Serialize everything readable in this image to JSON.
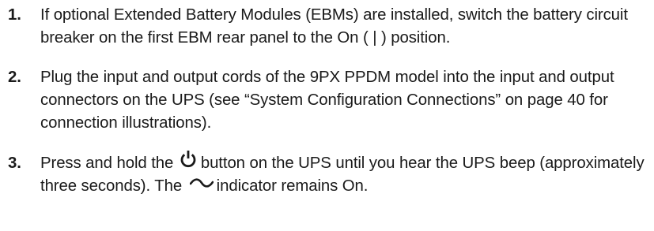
{
  "steps": [
    {
      "number": "1.",
      "text": "If optional Extended Battery Modules (EBMs) are installed, switch the battery circuit breaker on the first EBM rear panel to the On ( | ) position."
    },
    {
      "number": "2.",
      "text": "Plug the input and output cords of the 9PX PPDM model into the input and output connectors on the UPS (see “System Configuration Connections” on page 40 for connection illustrations)."
    },
    {
      "number": "3.",
      "text_before_power_icon": "Press and hold the",
      "text_after_power_icon": "button on the UPS until you hear the UPS beep (approximately three seconds). The",
      "text_after_ac_icon": "indicator remains On."
    }
  ],
  "icons": {
    "power": "power-icon",
    "ac_line": "ac-line-icon"
  }
}
